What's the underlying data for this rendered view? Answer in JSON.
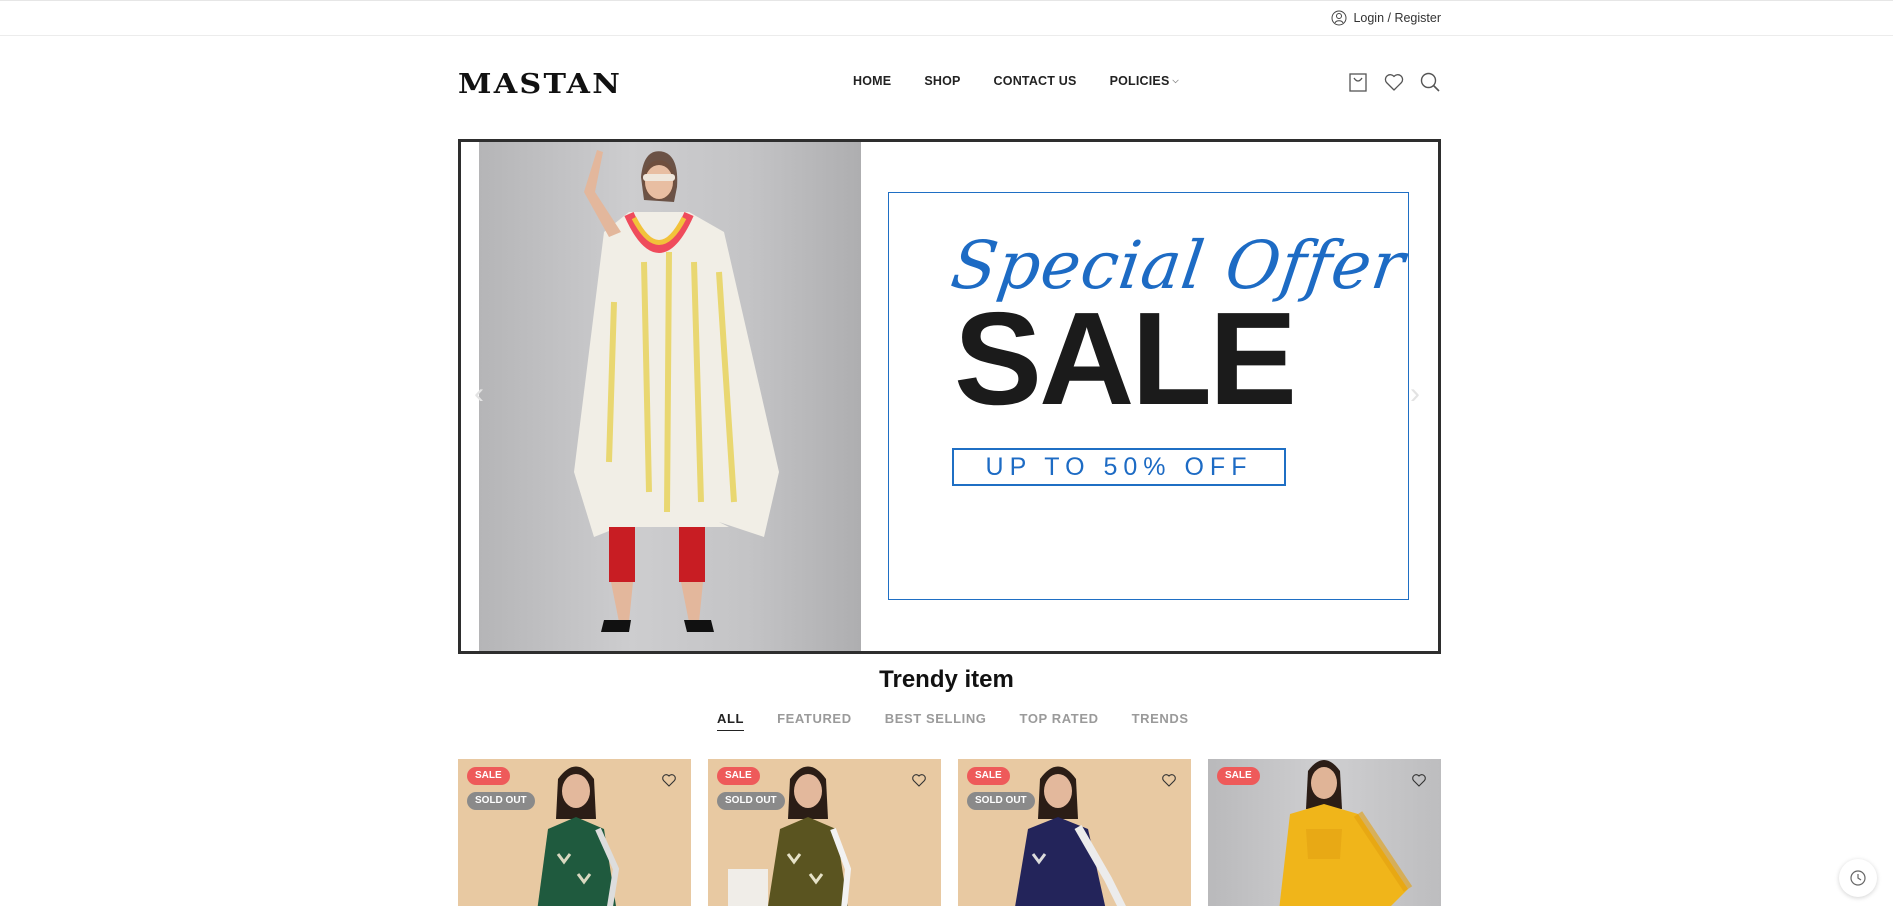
{
  "topbar": {
    "login_label": "Login / Register",
    "icon": "user-icon"
  },
  "header": {
    "logo_text": "MASTAN",
    "nav": [
      {
        "label": "HOME"
      },
      {
        "label": "SHOP"
      },
      {
        "label": "CONTACT US"
      },
      {
        "label": "POLICIES",
        "has_dropdown": true
      }
    ],
    "icons": [
      "cart-icon",
      "heart-icon",
      "search-icon"
    ]
  },
  "banner": {
    "script_text": "Special Offer",
    "headline": "SALE",
    "subline": "UP TO 50% OFF",
    "prev_label": "‹",
    "next_label": "›",
    "accent_color": "#1d6bc4"
  },
  "trendy": {
    "title": "Trendy item",
    "tabs": [
      {
        "label": "ALL",
        "active": true
      },
      {
        "label": "FEATURED"
      },
      {
        "label": "BEST SELLING"
      },
      {
        "label": "TOP RATED"
      },
      {
        "label": "TRENDS"
      }
    ]
  },
  "products": [
    {
      "badges": [
        "SALE",
        "SOLD OUT"
      ],
      "outfit_color": "#1f5a3e"
    },
    {
      "badges": [
        "SALE",
        "SOLD OUT"
      ],
      "outfit_color": "#5a5420"
    },
    {
      "badges": [
        "SALE",
        "SOLD OUT"
      ],
      "outfit_color": "#23245a"
    },
    {
      "badges": [
        "SALE"
      ],
      "outfit_color": "#f0b51a"
    }
  ],
  "colors": {
    "sale_badge": "#ee5a5a",
    "sold_badge": "#8a8a8a"
  }
}
